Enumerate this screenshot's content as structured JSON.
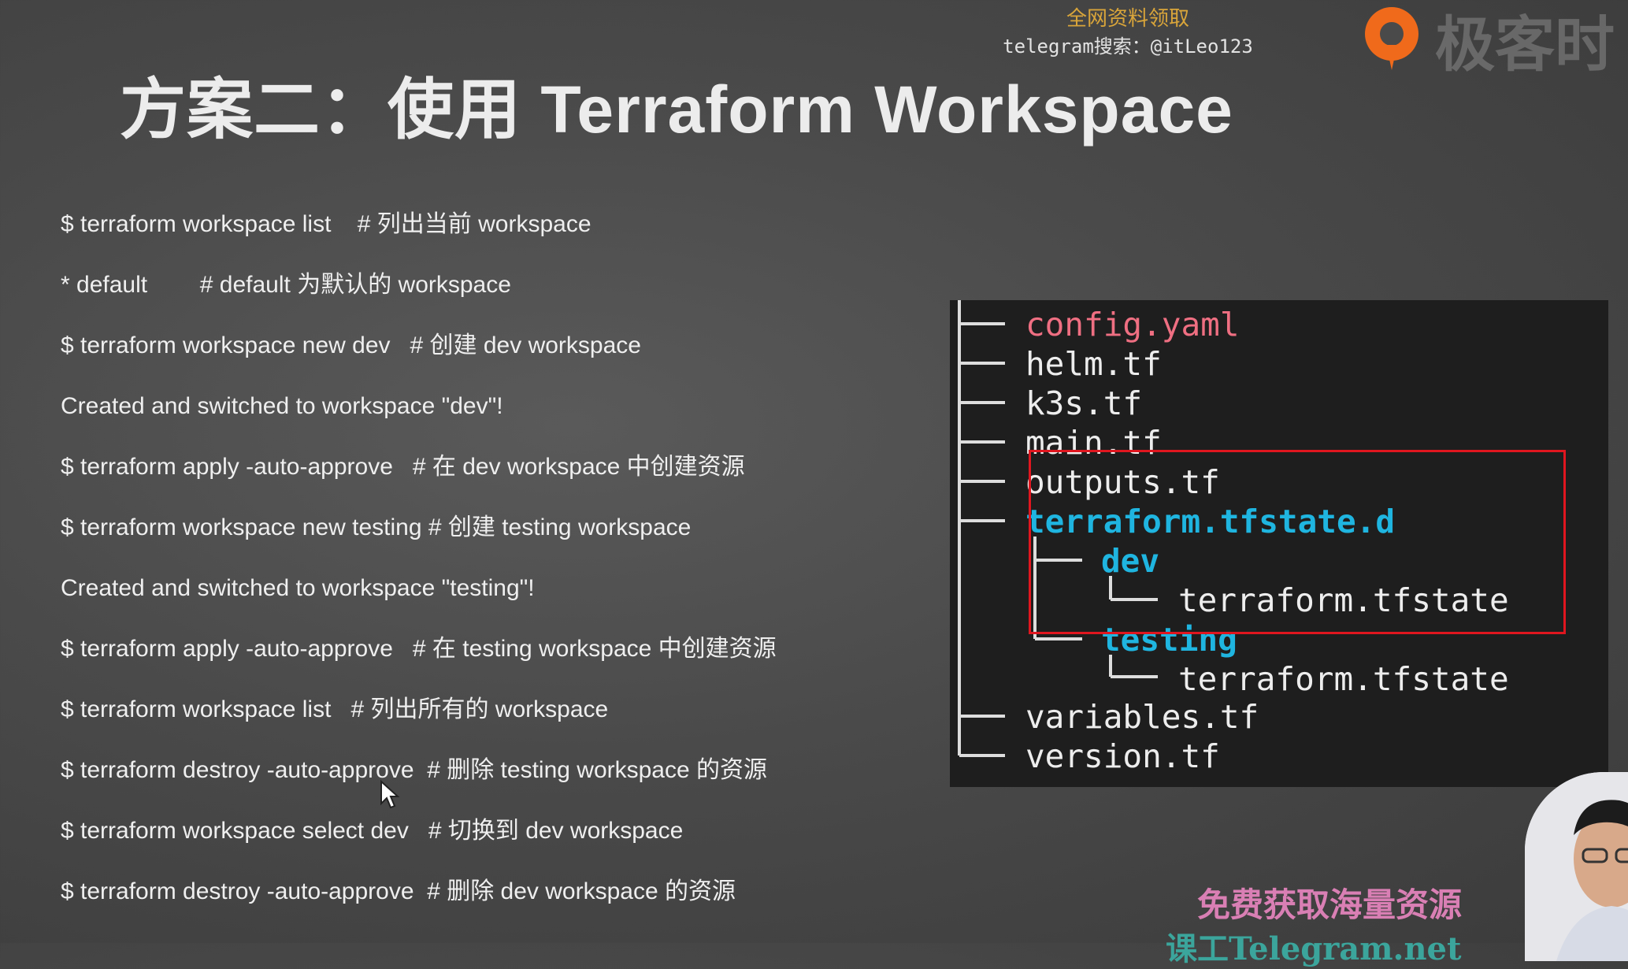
{
  "slide": {
    "title": "方案二：使用 Terraform Workspace"
  },
  "watermark": {
    "line1": "全网资料领取",
    "line2": "telegram搜索：@itLeo123"
  },
  "brand": {
    "name": "极客时",
    "logo_icon": "geektime-logo-icon",
    "logo_color": "#f06a1b"
  },
  "commands": [
    "$ terraform workspace list    # 列出当前 workspace",
    "* default        # default 为默认的 workspace",
    "$ terraform workspace new dev   # 创建 dev workspace",
    "Created and switched to workspace \"dev\"!",
    "$ terraform apply -auto-approve   # 在 dev workspace 中创建资源",
    "$ terraform workspace new testing # 创建 testing workspace",
    "Created and switched to workspace \"testing\"!",
    "$ terraform apply -auto-approve   # 在 testing workspace 中创建资源",
    "$ terraform workspace list   # 列出所有的 workspace",
    "$ terraform destroy -auto-approve  # 删除 testing workspace 的资源",
    "$ terraform workspace select dev   # 切换到 dev workspace",
    "$ terraform destroy -auto-approve  # 删除 dev workspace 的资源"
  ],
  "tree": [
    {
      "name": "config.yaml",
      "depth": 0,
      "kind": "yaml"
    },
    {
      "name": "helm.tf",
      "depth": 0,
      "kind": "file"
    },
    {
      "name": "k3s.tf",
      "depth": 0,
      "kind": "file"
    },
    {
      "name": "main.tf",
      "depth": 0,
      "kind": "file"
    },
    {
      "name": "outputs.tf",
      "depth": 0,
      "kind": "file"
    },
    {
      "name": "terraform.tfstate.d",
      "depth": 0,
      "kind": "dir"
    },
    {
      "name": "dev",
      "depth": 1,
      "kind": "dir"
    },
    {
      "name": "terraform.tfstate",
      "depth": 2,
      "kind": "file"
    },
    {
      "name": "testing",
      "depth": 1,
      "kind": "dir"
    },
    {
      "name": "terraform.tfstate",
      "depth": 2,
      "kind": "file"
    },
    {
      "name": "variables.tf",
      "depth": 0,
      "kind": "file"
    },
    {
      "name": "version.tf",
      "depth": 0,
      "kind": "file"
    }
  ],
  "promo": {
    "text": "免费获取海量资源",
    "sub": "课工Telegram.net"
  },
  "colors": {
    "yaml": "#ef6f82",
    "dir": "#1fb5e0",
    "highlight": "#e0161f"
  }
}
